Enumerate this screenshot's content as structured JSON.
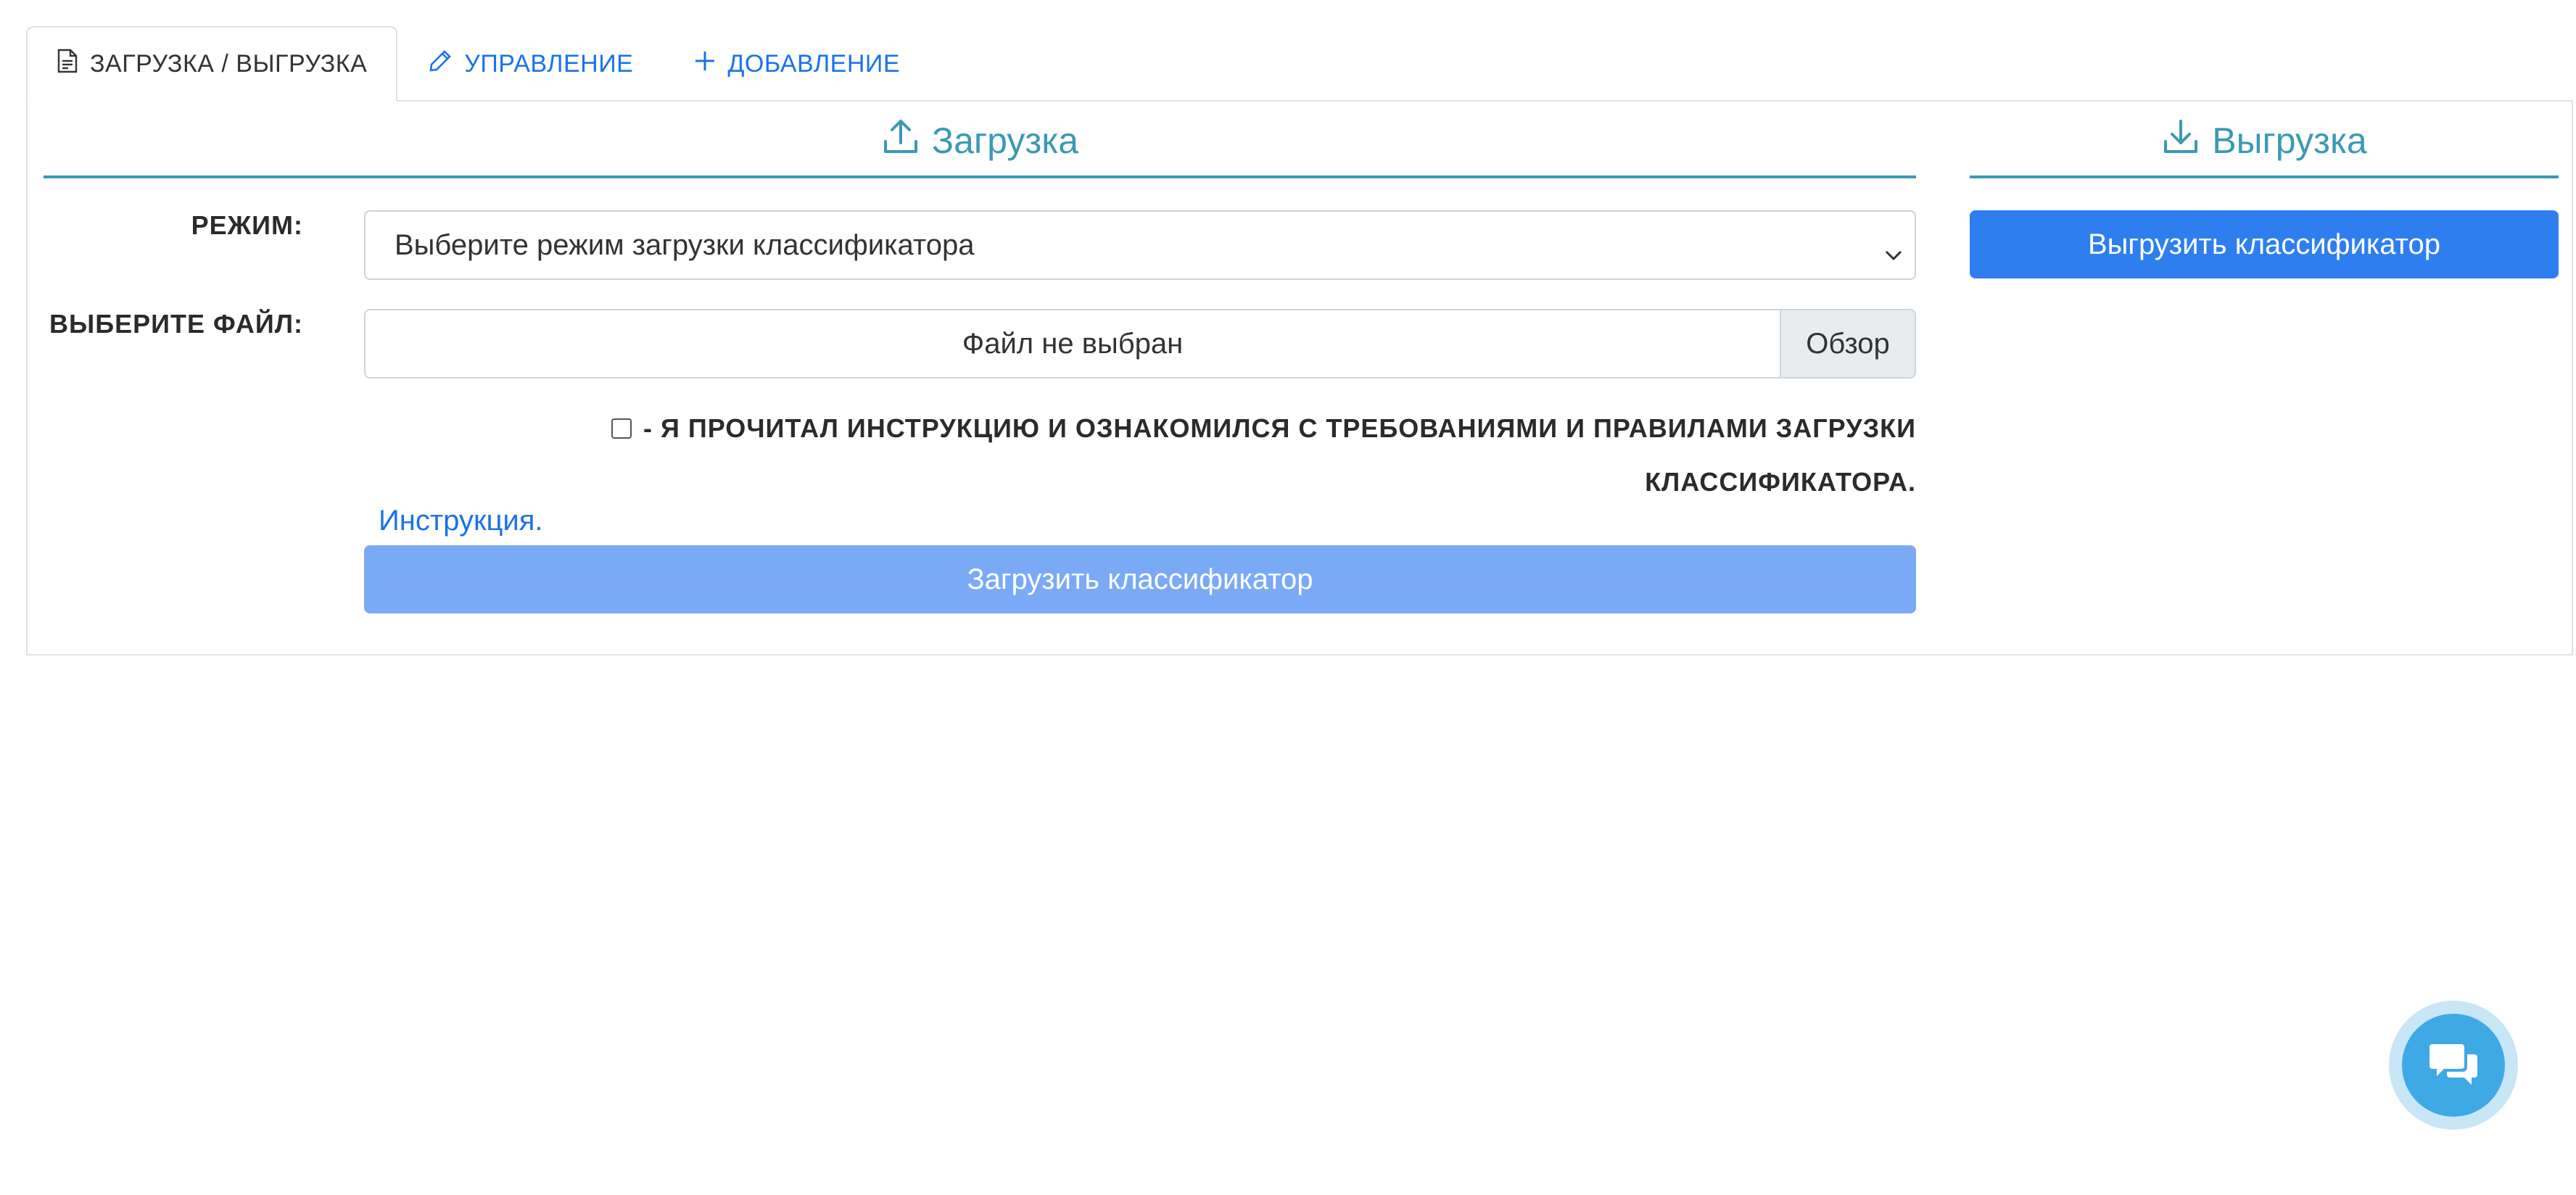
{
  "tabs": [
    {
      "label": "Загрузка / Выгрузка",
      "icon": "document-icon",
      "active": true
    },
    {
      "label": "Управление",
      "icon": "pencil-icon",
      "active": false
    },
    {
      "label": "Добавление",
      "icon": "plus-icon",
      "active": false
    }
  ],
  "upload": {
    "title": "Загрузка",
    "icon": "upload-icon",
    "mode_label": "Режим:",
    "mode_select_value": "Выберите режим загрузки классификатора",
    "file_label": "Выберите файл:",
    "file_name": "Файл не выбран",
    "browse_label": "Обзор",
    "agree_text": "- Я прочитал инструкцию и ознакомился с требованиями и правилами загрузки классификатора.",
    "instruction_link": "Инструкция.",
    "upload_button": "Загрузить классификатор"
  },
  "download": {
    "title": "Выгрузка",
    "icon": "download-icon",
    "download_button": "Выгрузить классификатор"
  },
  "chat": {
    "icon": "chat-icon"
  },
  "colors": {
    "accent": "#3a9ab2",
    "link": "#1a73e8",
    "primary_button": "#2f7ef0",
    "disabled_button": "#7aaaf5",
    "chat": "#3fa9e5"
  }
}
